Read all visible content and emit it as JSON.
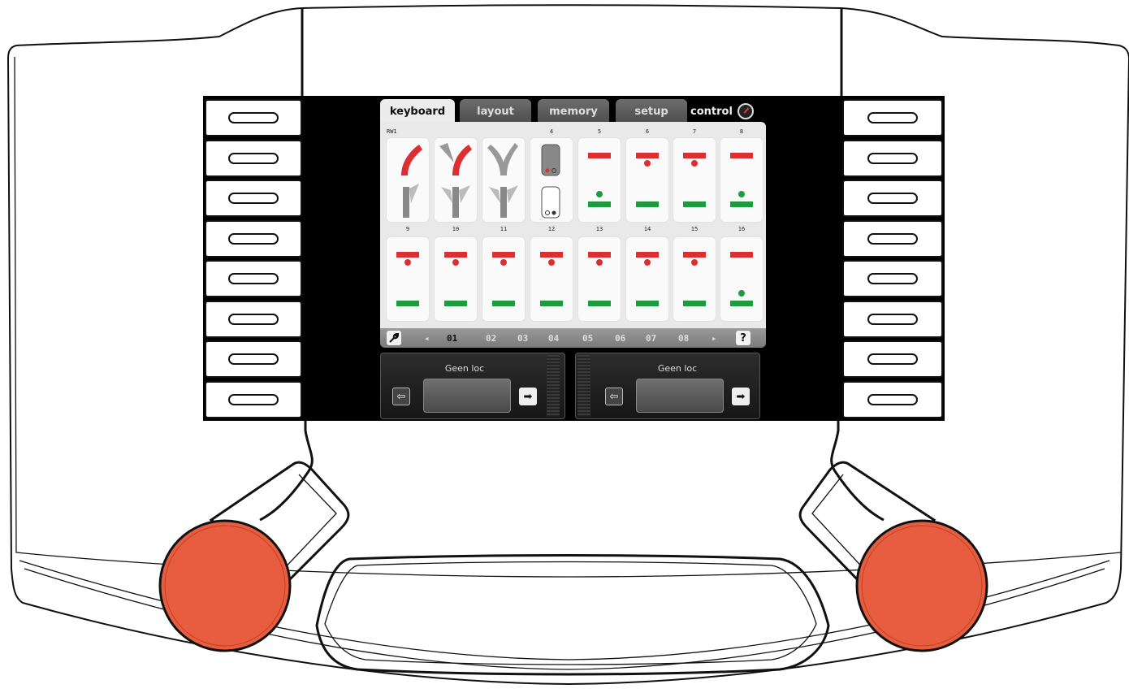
{
  "tabs": [
    {
      "label": "keyboard",
      "active": true
    },
    {
      "label": "layout",
      "active": false
    },
    {
      "label": "memory",
      "active": false
    },
    {
      "label": "setup",
      "active": false
    }
  ],
  "control": {
    "label": "control",
    "icon": "gauge-icon"
  },
  "keyboard": {
    "row1": [
      {
        "label": "RW1",
        "type": "turnout-curve"
      },
      {
        "label": "",
        "type": "turnout-wye-left"
      },
      {
        "label": "",
        "type": "turnout-wye"
      },
      {
        "label": "4",
        "type": "uncoupler"
      },
      {
        "label": "5",
        "type": "signal-red-off"
      },
      {
        "label": "6",
        "type": "signal-red"
      },
      {
        "label": "7",
        "type": "signal-red"
      },
      {
        "label": "8",
        "type": "signal-red-off"
      }
    ],
    "row2": [
      {
        "label": "9",
        "type": "signal-red"
      },
      {
        "label": "10",
        "type": "signal-red"
      },
      {
        "label": "11",
        "type": "signal-red"
      },
      {
        "label": "12",
        "type": "signal-red"
      },
      {
        "label": "13",
        "type": "signal-red"
      },
      {
        "label": "14",
        "type": "signal-red"
      },
      {
        "label": "15",
        "type": "signal-red"
      },
      {
        "label": "16",
        "type": "signal-red-off"
      }
    ]
  },
  "pager": {
    "pages": [
      "01",
      "02",
      "03",
      "04",
      "05",
      "06",
      "07",
      "08"
    ],
    "active": "01",
    "prev": "◂",
    "next": "▸",
    "help": "?",
    "settings_icon": "wrench-icon"
  },
  "locos": [
    {
      "name": "Geen loc",
      "left_icon": "⇦",
      "right_icon": "➡"
    },
    {
      "name": "Geen loc",
      "left_icon": "⇦",
      "right_icon": "➡"
    }
  ],
  "colors": {
    "red": "#dc2f32",
    "green": "#1f9a3e",
    "knob": "#e85d3f"
  }
}
